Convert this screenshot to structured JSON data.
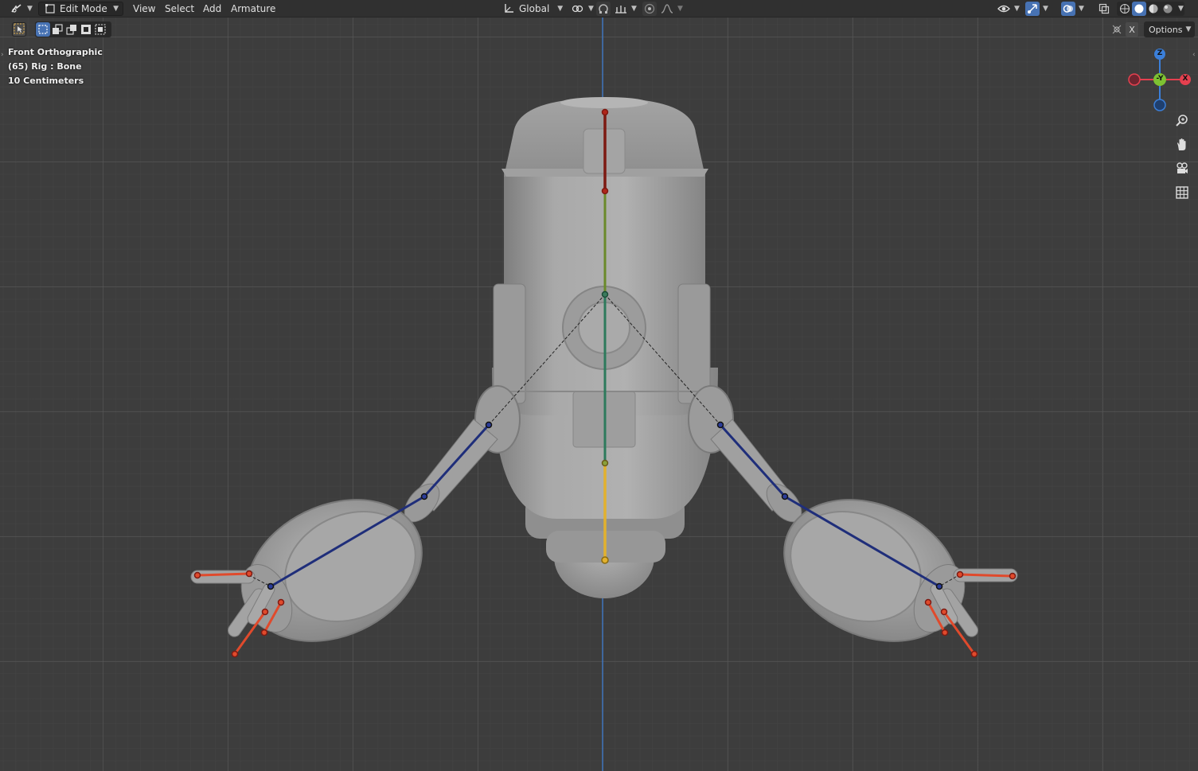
{
  "header": {
    "editor_type_icon": "editor-type-icon",
    "mode": "Edit Mode",
    "menus": [
      "View",
      "Select",
      "Add",
      "Armature"
    ],
    "transform_orientation": "Global",
    "pivot_icon": "pivot-icon",
    "snap_icon": "snap-icon",
    "proportional_icon": "proportional-editing-icon"
  },
  "tool_header": {
    "options_label": "Options",
    "close_label": "X"
  },
  "viewport": {
    "view_name": "Front Orthographic",
    "object_info": "(65) Rig : Bone",
    "scale_info": "10 Centimeters"
  },
  "gizmo": {
    "z": "Z",
    "y": "-Y",
    "x": "X",
    "colors": {
      "x": "#e5404f",
      "y": "#7dc232",
      "z": "#3b7fd9"
    }
  },
  "colors": {
    "bone_blue": "#1f2e7a",
    "bone_red": "#e04a2c",
    "bone_yellow": "#e2b12e",
    "bone_darkred": "#7d1a12",
    "bone_green": "#4f8a2e",
    "z_axis_line": "#3b7fd9"
  }
}
